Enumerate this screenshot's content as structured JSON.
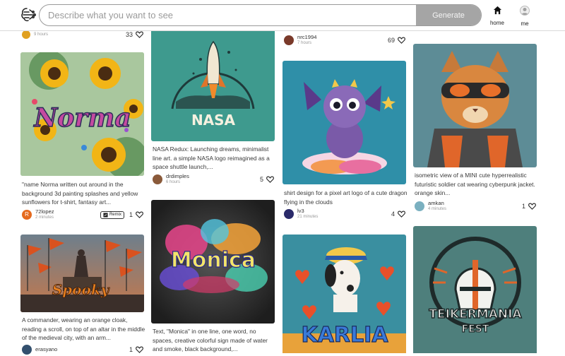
{
  "search": {
    "placeholder": "Describe what you want to see",
    "button_label": "Generate"
  },
  "nav": {
    "home_label": "home",
    "me_label": "me"
  },
  "col1": {
    "top": {
      "time": "9 hours",
      "likes": "33"
    },
    "c1": {
      "art_text": "Norma",
      "caption": "\"name Norma written out around in the background 3d painting splashes and yellow sunflowers for t-shirt, fantasy art...",
      "user": "72lopez",
      "avatar_letter": "R",
      "time": "2 minutes",
      "remix": "Remix",
      "likes": "1"
    },
    "c2": {
      "art_text": "Spooky",
      "caption": "A commander, wearing an orange cloak, reading a scroll, on top of an altar in the middle of the medieval city, with an arm...",
      "user": "erasyano",
      "likes": "1"
    }
  },
  "col2": {
    "c1": {
      "art_text": "NASA",
      "caption": "NASA Redux: Launching dreams, minimalist line art. a simple NASA logo reimagined as a space shuttle launch,...",
      "user": "drdimples",
      "time": "6 hours",
      "likes": "5"
    },
    "c2": {
      "art_text": "Monica",
      "caption": "Text, \"Monica\" in one line, one word, no spaces, creative colorful sign made of water and smoke, black background,..."
    }
  },
  "col3": {
    "top": {
      "user": "nrc1994",
      "time": "7 hours",
      "likes": "69"
    },
    "c1": {
      "caption": "shirt design for a pixel art logo of a cute dragon flying in the clouds",
      "user": "lv3",
      "time": "21 minutes",
      "likes": "4"
    },
    "c2": {
      "art_text": "KARLIA"
    }
  },
  "col4": {
    "c1": {
      "caption": "isometric view of a MINI cute hyperrealistic futuristic soldier cat wearing cyberpunk jacket. orange skin...",
      "user": "amkan",
      "time": "4 minutes",
      "likes": "1"
    },
    "c2": {
      "art_text_1": "TEIKERMANIA",
      "art_text_2": "FEST"
    }
  },
  "colors": {
    "button_bg": "#a5a5a5",
    "border": "#9a9a9a",
    "teal": "#3e9a8e"
  }
}
